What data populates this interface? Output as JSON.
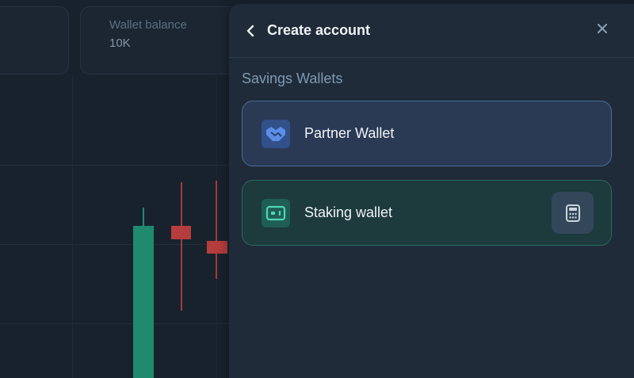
{
  "background": {
    "wallet_card": {
      "label": "Wallet balance",
      "value": "10K"
    }
  },
  "panel": {
    "title": "Create account",
    "section_title": "Savings Wallets",
    "items": [
      {
        "label": "Partner Wallet",
        "icon": "handshake-icon"
      },
      {
        "label": "Staking wallet",
        "icon": "wallet-icon",
        "action_icon": "calculator-icon"
      }
    ]
  },
  "colors": {
    "panel_bg": "#1f2b38",
    "partner_accent": "#4b6a9a",
    "staking_accent": "#2a6a60",
    "candle_up": "#1f8a6e",
    "candle_down": "#b53d3d"
  }
}
